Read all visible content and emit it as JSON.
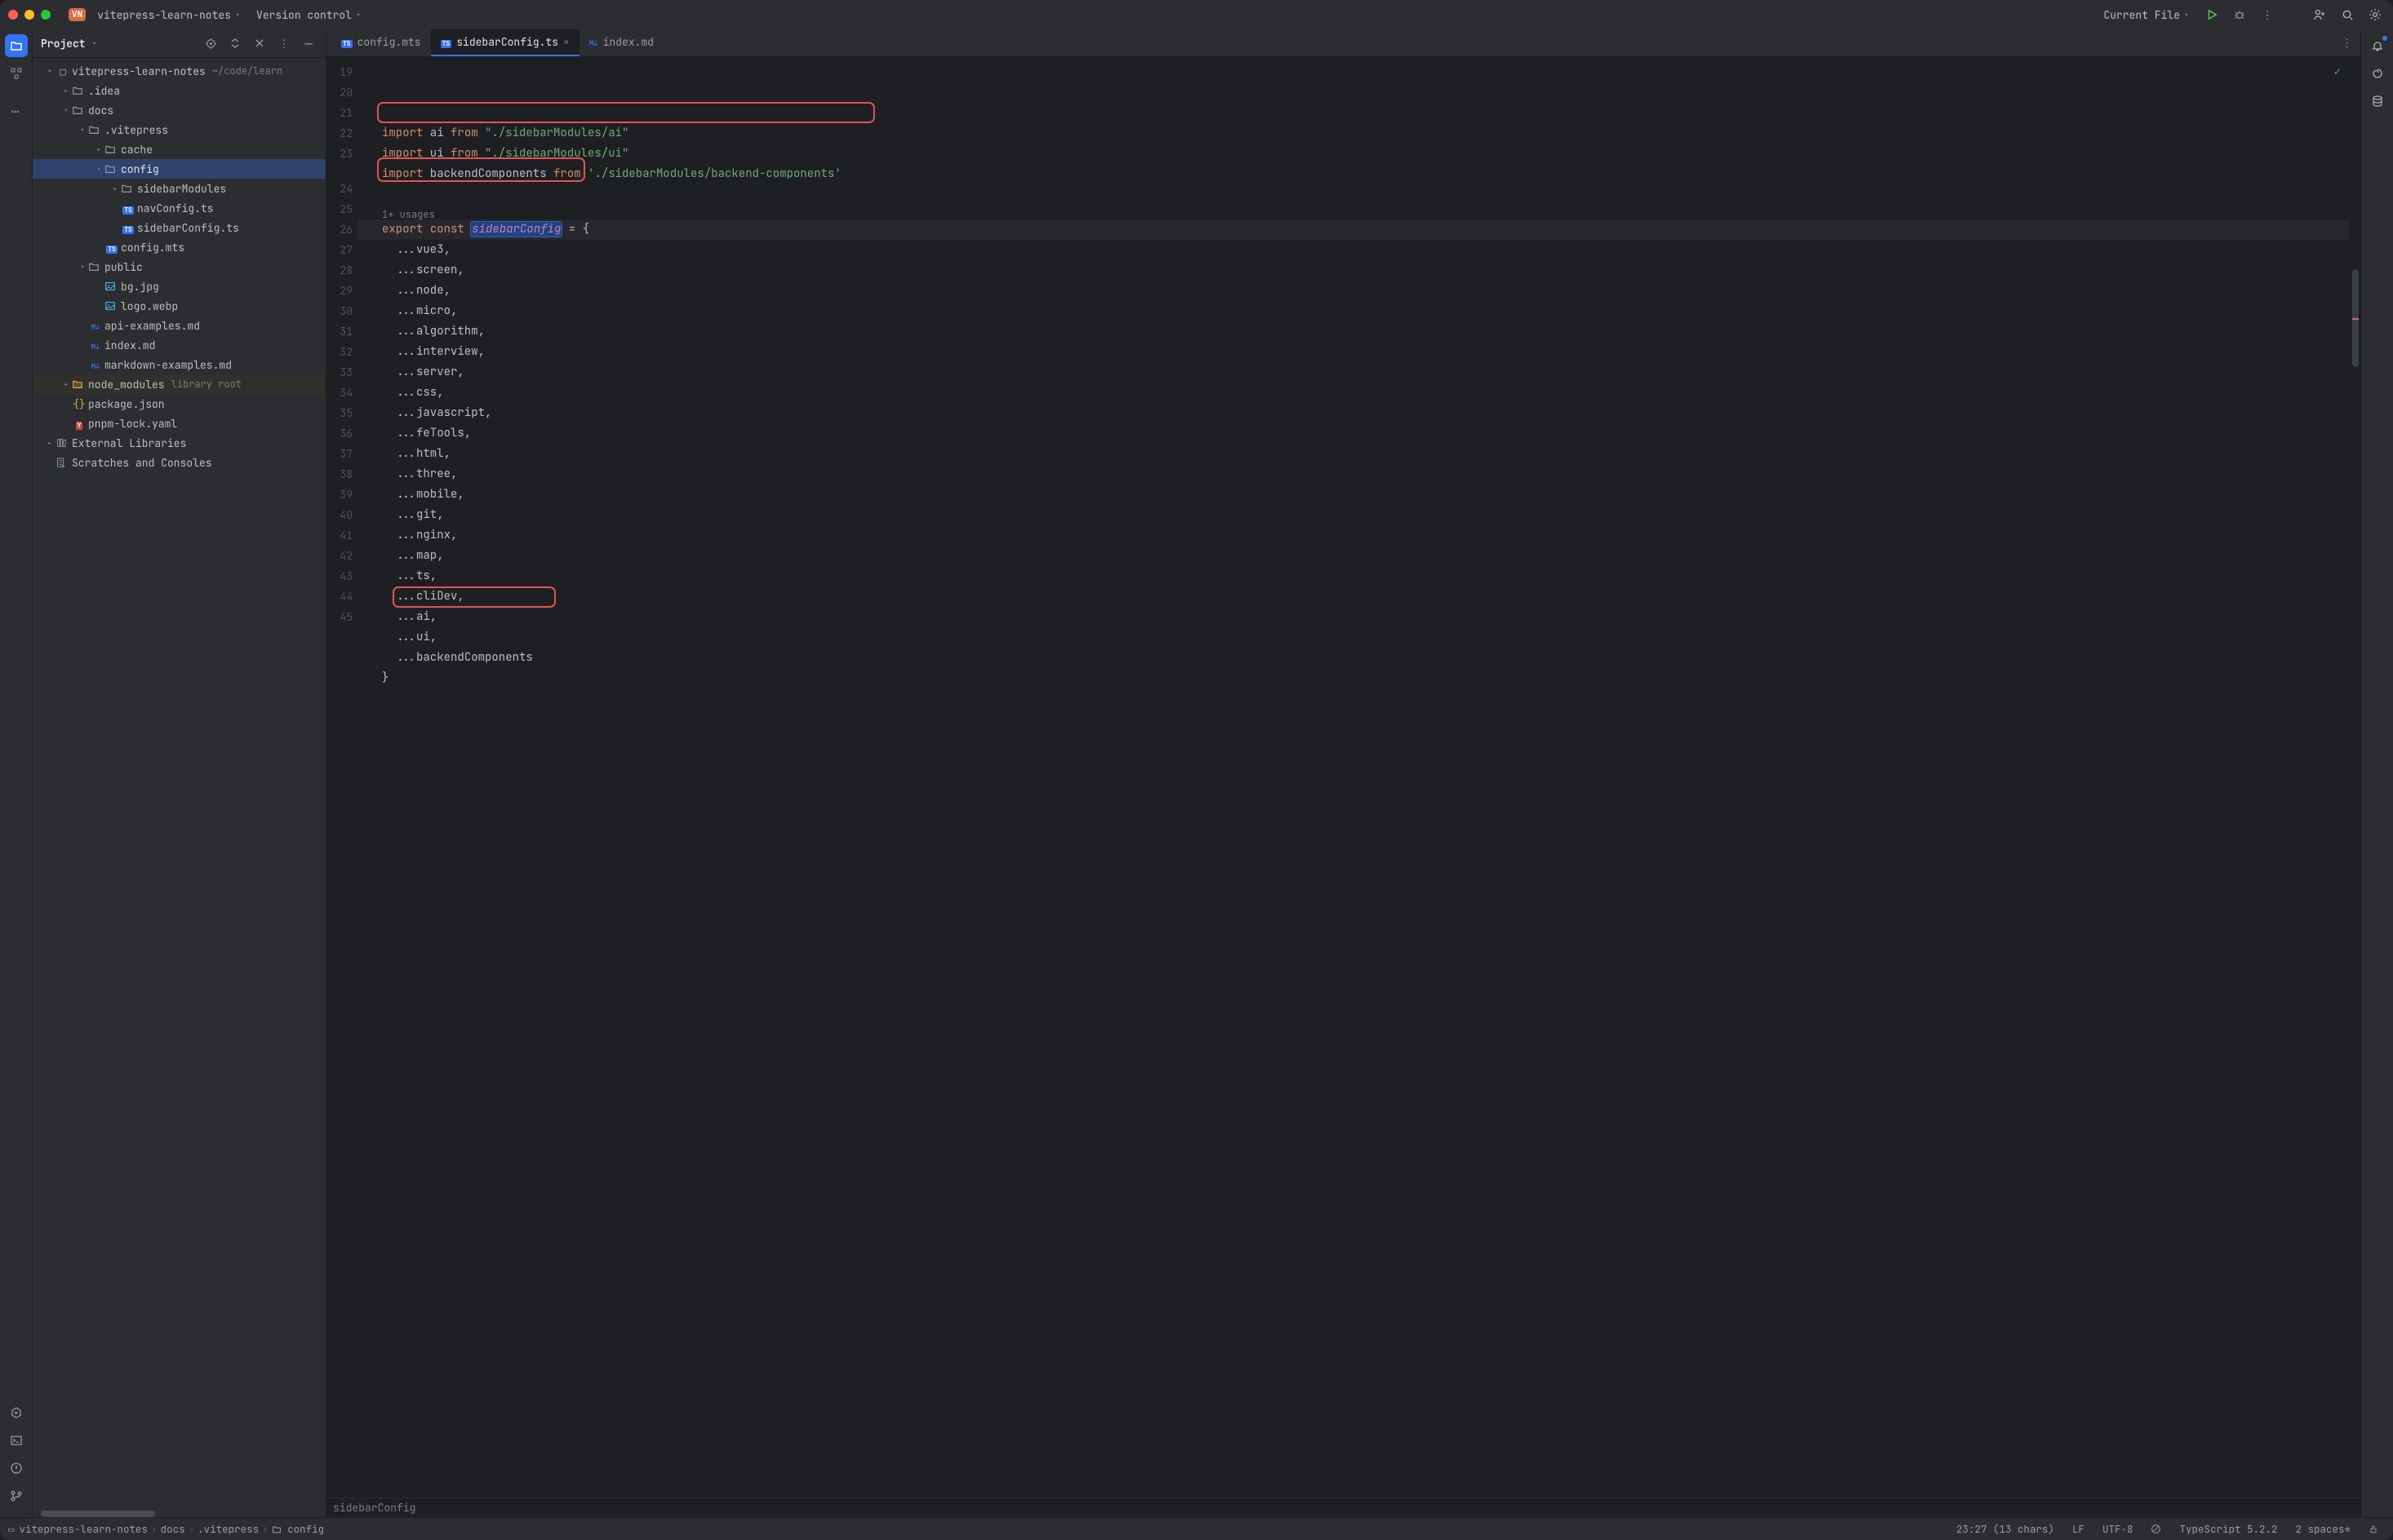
{
  "titlebar": {
    "project_badge": "VN",
    "project_name": "vitepress-learn-notes",
    "vcs_label": "Version control",
    "run_config": "Current File"
  },
  "project_panel": {
    "title": "Project",
    "root": {
      "name": "vitepress-learn-notes",
      "path_hint": "~/code/learn"
    },
    "tree": [
      {
        "depth": 0,
        "arrow": "down",
        "icon": "folder-root",
        "label": "vitepress-learn-notes",
        "hint": "~/code/learn"
      },
      {
        "depth": 1,
        "arrow": "right",
        "icon": "folder",
        "label": ".idea"
      },
      {
        "depth": 1,
        "arrow": "down",
        "icon": "folder",
        "label": "docs"
      },
      {
        "depth": 2,
        "arrow": "down",
        "icon": "folder",
        "label": ".vitepress"
      },
      {
        "depth": 3,
        "arrow": "right",
        "icon": "folder",
        "label": "cache"
      },
      {
        "depth": 3,
        "arrow": "down",
        "icon": "folder",
        "label": "config",
        "selected": true
      },
      {
        "depth": 4,
        "arrow": "right",
        "icon": "folder",
        "label": "sidebarModules"
      },
      {
        "depth": 4,
        "arrow": "",
        "icon": "ts",
        "label": "navConfig.ts"
      },
      {
        "depth": 4,
        "arrow": "",
        "icon": "ts",
        "label": "sidebarConfig.ts"
      },
      {
        "depth": 3,
        "arrow": "",
        "icon": "ts",
        "label": "config.mts"
      },
      {
        "depth": 2,
        "arrow": "down",
        "icon": "folder",
        "label": "public"
      },
      {
        "depth": 3,
        "arrow": "",
        "icon": "img",
        "label": "bg.jpg"
      },
      {
        "depth": 3,
        "arrow": "",
        "icon": "img",
        "label": "logo.webp"
      },
      {
        "depth": 2,
        "arrow": "",
        "icon": "md",
        "label": "api-examples.md"
      },
      {
        "depth": 2,
        "arrow": "",
        "icon": "md",
        "label": "index.md"
      },
      {
        "depth": 2,
        "arrow": "",
        "icon": "md",
        "label": "markdown-examples.md"
      },
      {
        "depth": 1,
        "arrow": "right",
        "icon": "folder-excl",
        "label": "node_modules",
        "hint": "library root",
        "dim": true
      },
      {
        "depth": 1,
        "arrow": "",
        "icon": "json",
        "label": "package.json"
      },
      {
        "depth": 1,
        "arrow": "",
        "icon": "yaml",
        "label": "pnpm-lock.yaml"
      },
      {
        "depth": 0,
        "arrow": "right",
        "icon": "lib",
        "label": "External Libraries"
      },
      {
        "depth": 0,
        "arrow": "",
        "icon": "scratch",
        "label": "Scratches and Consoles"
      }
    ]
  },
  "tabs": [
    {
      "icon": "ts",
      "label": "config.mts",
      "active": false
    },
    {
      "icon": "ts",
      "label": "sidebarConfig.ts",
      "active": true,
      "closeable": true
    },
    {
      "icon": "md",
      "label": "index.md",
      "active": false
    }
  ],
  "editor": {
    "usages_hint": "1+ usages",
    "gutter_start": 19,
    "gutter_end": 45,
    "lines": {
      "l19": {
        "indent": "",
        "tokens": [
          [
            "kw",
            "import"
          ],
          [
            "id",
            " ai "
          ],
          [
            "kw",
            "from"
          ],
          [
            "id",
            " "
          ],
          [
            "str",
            "\"./sidebarModules/ai\""
          ]
        ]
      },
      "l20": {
        "indent": "",
        "tokens": [
          [
            "kw",
            "import"
          ],
          [
            "id",
            " ui "
          ],
          [
            "kw",
            "from"
          ],
          [
            "id",
            " "
          ],
          [
            "str",
            "\"./sidebarModules/ui\""
          ]
        ]
      },
      "l21": {
        "indent": "",
        "tokens": [
          [
            "kw",
            "import"
          ],
          [
            "id",
            " backendComponents "
          ],
          [
            "kw",
            "from"
          ],
          [
            "id",
            " "
          ],
          [
            "str",
            "'./sidebarModules/backend-components'"
          ]
        ]
      },
      "l22": {
        "indent": "",
        "tokens": []
      },
      "l23": {
        "indent": "",
        "tokens": [
          [
            "kw",
            "export"
          ],
          [
            "id",
            " "
          ],
          [
            "kw",
            "const"
          ],
          [
            "id",
            " "
          ],
          [
            "decl-sel",
            "sidebarConfig"
          ],
          [
            "id",
            " = {"
          ]
        ]
      },
      "l24": {
        "indent": "  ",
        "tokens": [
          [
            "id",
            "...vue3,"
          ]
        ]
      },
      "l25": {
        "indent": "  ",
        "tokens": [
          [
            "id",
            "...screen,"
          ]
        ]
      },
      "l26": {
        "indent": "  ",
        "tokens": [
          [
            "id",
            "...node,"
          ]
        ]
      },
      "l27": {
        "indent": "  ",
        "tokens": [
          [
            "id",
            "...micro,"
          ]
        ]
      },
      "l28": {
        "indent": "  ",
        "tokens": [
          [
            "id",
            "...algorithm,"
          ]
        ]
      },
      "l29": {
        "indent": "  ",
        "tokens": [
          [
            "id",
            "...interview,"
          ]
        ]
      },
      "l30": {
        "indent": "  ",
        "tokens": [
          [
            "id",
            "...server,"
          ]
        ]
      },
      "l31": {
        "indent": "  ",
        "tokens": [
          [
            "id",
            "...css,"
          ]
        ]
      },
      "l32": {
        "indent": "  ",
        "tokens": [
          [
            "id",
            "...javascript,"
          ]
        ]
      },
      "l33": {
        "indent": "  ",
        "tokens": [
          [
            "id",
            "...feTools,"
          ]
        ]
      },
      "l34": {
        "indent": "  ",
        "tokens": [
          [
            "id",
            "...html,"
          ]
        ]
      },
      "l35": {
        "indent": "  ",
        "tokens": [
          [
            "id",
            "...three,"
          ]
        ]
      },
      "l36": {
        "indent": "  ",
        "tokens": [
          [
            "id",
            "...mobile,"
          ]
        ]
      },
      "l37": {
        "indent": "  ",
        "tokens": [
          [
            "id",
            "...git,"
          ]
        ]
      },
      "l38": {
        "indent": "  ",
        "tokens": [
          [
            "id",
            "...nginx,"
          ]
        ]
      },
      "l39": {
        "indent": "  ",
        "tokens": [
          [
            "id",
            "...map,"
          ]
        ]
      },
      "l40": {
        "indent": "  ",
        "tokens": [
          [
            "id",
            "...ts,"
          ]
        ]
      },
      "l41": {
        "indent": "  ",
        "tokens": [
          [
            "id",
            "...cliDev,"
          ]
        ]
      },
      "l42": {
        "indent": "  ",
        "tokens": [
          [
            "id",
            "...ai,"
          ]
        ]
      },
      "l43": {
        "indent": "  ",
        "tokens": [
          [
            "id",
            "...ui,"
          ]
        ]
      },
      "l44": {
        "indent": "  ",
        "tokens": [
          [
            "id",
            "...backendComponents"
          ]
        ]
      },
      "l45": {
        "indent": "",
        "tokens": [
          [
            "id",
            "}"
          ]
        ]
      }
    },
    "breadcrumb": "sidebarConfig"
  },
  "statusbar": {
    "crumbs": [
      "vitepress-learn-notes",
      "docs",
      ".vitepress",
      "config"
    ],
    "cursor": "23:27 (13 chars)",
    "line_sep": "LF",
    "encoding": "UTF-8",
    "lang": "TypeScript 5.2.2",
    "indent": "2 spaces*"
  },
  "colors": {
    "accent": "#3574f0",
    "keyword": "#cf8e6d",
    "string": "#6aab73",
    "highlight_box": "#e55353"
  }
}
